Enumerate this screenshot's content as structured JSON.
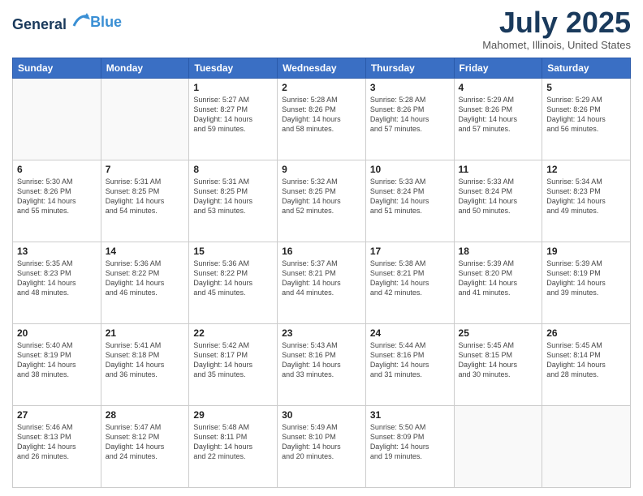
{
  "header": {
    "logo_line1": "General",
    "logo_line2": "Blue",
    "month_title": "July 2025",
    "location": "Mahomet, Illinois, United States"
  },
  "weekdays": [
    "Sunday",
    "Monday",
    "Tuesday",
    "Wednesday",
    "Thursday",
    "Friday",
    "Saturday"
  ],
  "weeks": [
    [
      {
        "day": "",
        "detail": ""
      },
      {
        "day": "",
        "detail": ""
      },
      {
        "day": "1",
        "detail": "Sunrise: 5:27 AM\nSunset: 8:27 PM\nDaylight: 14 hours\nand 59 minutes."
      },
      {
        "day": "2",
        "detail": "Sunrise: 5:28 AM\nSunset: 8:26 PM\nDaylight: 14 hours\nand 58 minutes."
      },
      {
        "day": "3",
        "detail": "Sunrise: 5:28 AM\nSunset: 8:26 PM\nDaylight: 14 hours\nand 57 minutes."
      },
      {
        "day": "4",
        "detail": "Sunrise: 5:29 AM\nSunset: 8:26 PM\nDaylight: 14 hours\nand 57 minutes."
      },
      {
        "day": "5",
        "detail": "Sunrise: 5:29 AM\nSunset: 8:26 PM\nDaylight: 14 hours\nand 56 minutes."
      }
    ],
    [
      {
        "day": "6",
        "detail": "Sunrise: 5:30 AM\nSunset: 8:26 PM\nDaylight: 14 hours\nand 55 minutes."
      },
      {
        "day": "7",
        "detail": "Sunrise: 5:31 AM\nSunset: 8:25 PM\nDaylight: 14 hours\nand 54 minutes."
      },
      {
        "day": "8",
        "detail": "Sunrise: 5:31 AM\nSunset: 8:25 PM\nDaylight: 14 hours\nand 53 minutes."
      },
      {
        "day": "9",
        "detail": "Sunrise: 5:32 AM\nSunset: 8:25 PM\nDaylight: 14 hours\nand 52 minutes."
      },
      {
        "day": "10",
        "detail": "Sunrise: 5:33 AM\nSunset: 8:24 PM\nDaylight: 14 hours\nand 51 minutes."
      },
      {
        "day": "11",
        "detail": "Sunrise: 5:33 AM\nSunset: 8:24 PM\nDaylight: 14 hours\nand 50 minutes."
      },
      {
        "day": "12",
        "detail": "Sunrise: 5:34 AM\nSunset: 8:23 PM\nDaylight: 14 hours\nand 49 minutes."
      }
    ],
    [
      {
        "day": "13",
        "detail": "Sunrise: 5:35 AM\nSunset: 8:23 PM\nDaylight: 14 hours\nand 48 minutes."
      },
      {
        "day": "14",
        "detail": "Sunrise: 5:36 AM\nSunset: 8:22 PM\nDaylight: 14 hours\nand 46 minutes."
      },
      {
        "day": "15",
        "detail": "Sunrise: 5:36 AM\nSunset: 8:22 PM\nDaylight: 14 hours\nand 45 minutes."
      },
      {
        "day": "16",
        "detail": "Sunrise: 5:37 AM\nSunset: 8:21 PM\nDaylight: 14 hours\nand 44 minutes."
      },
      {
        "day": "17",
        "detail": "Sunrise: 5:38 AM\nSunset: 8:21 PM\nDaylight: 14 hours\nand 42 minutes."
      },
      {
        "day": "18",
        "detail": "Sunrise: 5:39 AM\nSunset: 8:20 PM\nDaylight: 14 hours\nand 41 minutes."
      },
      {
        "day": "19",
        "detail": "Sunrise: 5:39 AM\nSunset: 8:19 PM\nDaylight: 14 hours\nand 39 minutes."
      }
    ],
    [
      {
        "day": "20",
        "detail": "Sunrise: 5:40 AM\nSunset: 8:19 PM\nDaylight: 14 hours\nand 38 minutes."
      },
      {
        "day": "21",
        "detail": "Sunrise: 5:41 AM\nSunset: 8:18 PM\nDaylight: 14 hours\nand 36 minutes."
      },
      {
        "day": "22",
        "detail": "Sunrise: 5:42 AM\nSunset: 8:17 PM\nDaylight: 14 hours\nand 35 minutes."
      },
      {
        "day": "23",
        "detail": "Sunrise: 5:43 AM\nSunset: 8:16 PM\nDaylight: 14 hours\nand 33 minutes."
      },
      {
        "day": "24",
        "detail": "Sunrise: 5:44 AM\nSunset: 8:16 PM\nDaylight: 14 hours\nand 31 minutes."
      },
      {
        "day": "25",
        "detail": "Sunrise: 5:45 AM\nSunset: 8:15 PM\nDaylight: 14 hours\nand 30 minutes."
      },
      {
        "day": "26",
        "detail": "Sunrise: 5:45 AM\nSunset: 8:14 PM\nDaylight: 14 hours\nand 28 minutes."
      }
    ],
    [
      {
        "day": "27",
        "detail": "Sunrise: 5:46 AM\nSunset: 8:13 PM\nDaylight: 14 hours\nand 26 minutes."
      },
      {
        "day": "28",
        "detail": "Sunrise: 5:47 AM\nSunset: 8:12 PM\nDaylight: 14 hours\nand 24 minutes."
      },
      {
        "day": "29",
        "detail": "Sunrise: 5:48 AM\nSunset: 8:11 PM\nDaylight: 14 hours\nand 22 minutes."
      },
      {
        "day": "30",
        "detail": "Sunrise: 5:49 AM\nSunset: 8:10 PM\nDaylight: 14 hours\nand 20 minutes."
      },
      {
        "day": "31",
        "detail": "Sunrise: 5:50 AM\nSunset: 8:09 PM\nDaylight: 14 hours\nand 19 minutes."
      },
      {
        "day": "",
        "detail": ""
      },
      {
        "day": "",
        "detail": ""
      }
    ]
  ]
}
